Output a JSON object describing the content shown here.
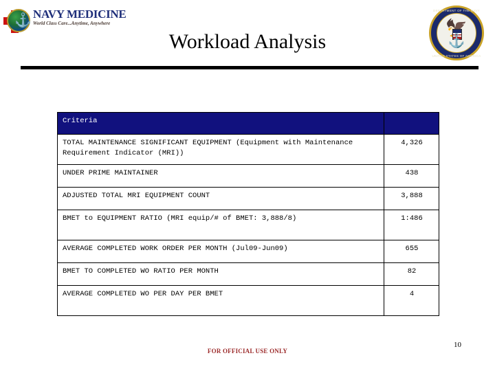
{
  "branding": {
    "logo": {
      "name": "NAVY MEDICINE",
      "tagline": "World Class Care...Anytime, Anywhere",
      "emblem_icon": "navy-medicine-globe-anchor-cross",
      "cross_color": "#cc1111",
      "text_color": "#1f2f7a"
    },
    "seal": {
      "icon": "department-of-the-navy-seal",
      "text_top": "DEPARTMENT OF THE NAVY",
      "text_bottom": "UNITED STATES OF AMERICA",
      "ring_color": "#1b2a6b",
      "trim_color": "#c9a227"
    }
  },
  "slide": {
    "title": "Workload Analysis",
    "page_number": "10",
    "classification": "FOR OFFICIAL USE ONLY",
    "classification_color": "#9c2b2b",
    "header_fill": "#11117e"
  },
  "table": {
    "columns": [
      "Criteria",
      ""
    ],
    "rows": [
      {
        "criteria": "TOTAL MAINTENANCE SIGNIFICANT EQUIPMENT (Equipment with Maintenance Requirement Indicator (MRI))",
        "value": "4,326",
        "tall": true
      },
      {
        "criteria": "UNDER PRIME MAINTAINER",
        "value": "438",
        "tall": false
      },
      {
        "criteria": "ADJUSTED TOTAL MRI EQUIPMENT COUNT",
        "value": "3,888",
        "tall": false
      },
      {
        "criteria": "BMET to EQUIPMENT RATIO (MRI equip/# of BMET: 3,888/8)",
        "value": "1:486",
        "tall": true
      },
      {
        "criteria": "AVERAGE COMPLETED WORK ORDER PER MONTH (Jul09-Jun09)",
        "value": "655",
        "tall": false
      },
      {
        "criteria": "BMET TO COMPLETED WO RATIO PER MONTH",
        "value": "82",
        "tall": false
      },
      {
        "criteria": "AVERAGE COMPLETED WO PER DAY PER BMET",
        "value": "4",
        "tall": true
      }
    ]
  }
}
